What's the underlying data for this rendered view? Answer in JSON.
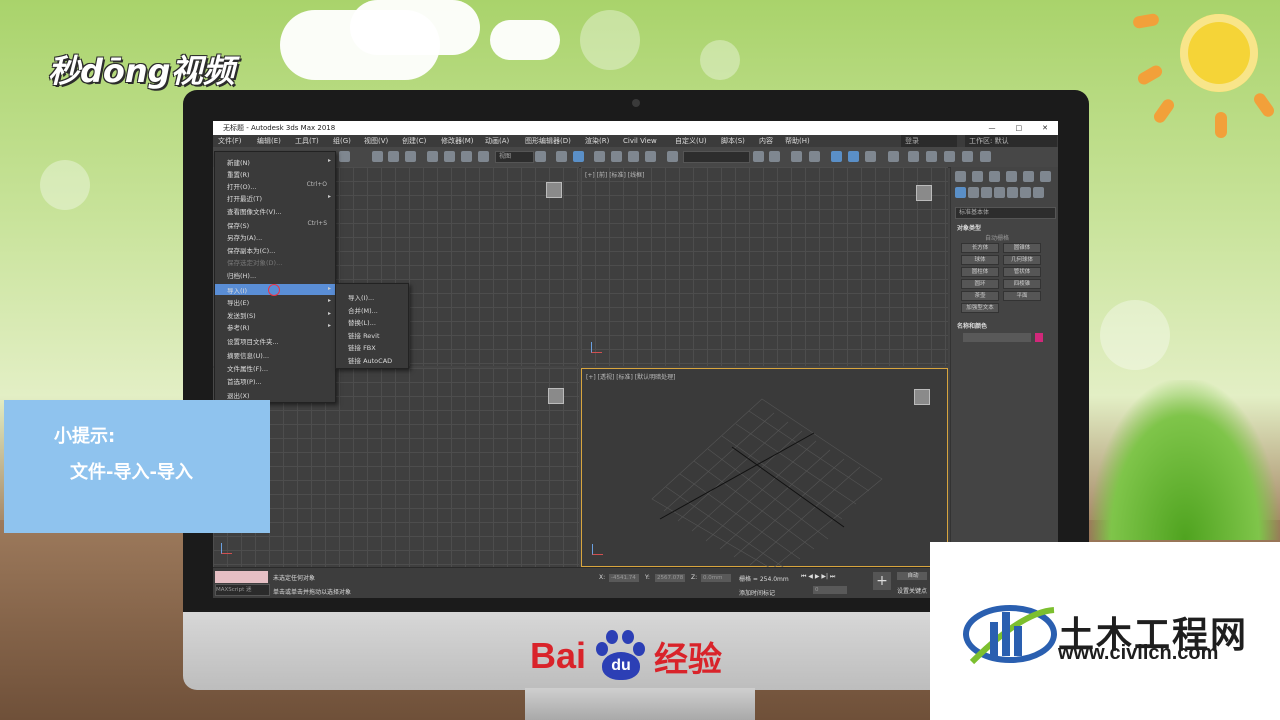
{
  "watermark": {
    "top_left": "秒dōng视频"
  },
  "window": {
    "title": "无标题 - Autodesk 3ds Max 2018",
    "controls": [
      "—",
      "□",
      "✕"
    ],
    "workspace_label": "工作区: 默认",
    "search_placeholder": "登录"
  },
  "menubar": [
    "文件(F)",
    "编辑(E)",
    "工具(T)",
    "组(G)",
    "视图(V)",
    "创建(C)",
    "修改器(M)",
    "动画(A)",
    "图形编辑器(D)",
    "渲染(R)",
    "Civil View",
    "自定义(U)",
    "脚本(S)",
    "内容",
    "帮助(H)"
  ],
  "toolbar": {
    "selection_filter": "视图",
    "selection_set": ""
  },
  "file_menu": {
    "items": [
      {
        "label": "新建(N)",
        "shortcut": "",
        "arrow": "▸",
        "dim": false
      },
      {
        "label": "重置(R)",
        "shortcut": "",
        "arrow": "",
        "dim": false
      },
      {
        "label": "打开(O)...",
        "shortcut": "Ctrl+O",
        "arrow": "",
        "dim": false
      },
      {
        "label": "打开最近(T)",
        "shortcut": "",
        "arrow": "▸",
        "dim": false
      },
      {
        "label": "查看图像文件(V)...",
        "shortcut": "",
        "arrow": "",
        "dim": false
      },
      {
        "label": "保存(S)",
        "shortcut": "Ctrl+S",
        "arrow": "",
        "dim": false
      },
      {
        "label": "另存为(A)...",
        "shortcut": "",
        "arrow": "",
        "dim": false
      },
      {
        "label": "保存副本为(C)...",
        "shortcut": "",
        "arrow": "",
        "dim": false
      },
      {
        "label": "保存选定对象(D)...",
        "shortcut": "",
        "arrow": "",
        "dim": true
      },
      {
        "label": "归档(H)...",
        "shortcut": "",
        "arrow": "",
        "dim": false
      },
      {
        "label": "导入(I)",
        "shortcut": "",
        "arrow": "▸",
        "dim": false
      },
      {
        "label": "导出(E)",
        "shortcut": "",
        "arrow": "▸",
        "dim": false
      },
      {
        "label": "发送到(S)",
        "shortcut": "",
        "arrow": "▸",
        "dim": false
      },
      {
        "label": "参考(R)",
        "shortcut": "",
        "arrow": "▸",
        "dim": false
      },
      {
        "label": "设置项目文件夹...",
        "shortcut": "",
        "arrow": "",
        "dim": false
      },
      {
        "label": "摘要信息(U)...",
        "shortcut": "",
        "arrow": "",
        "dim": false
      },
      {
        "label": "文件属性(F)...",
        "shortcut": "",
        "arrow": "",
        "dim": false
      },
      {
        "label": "首选项(P)...",
        "shortcut": "",
        "arrow": "",
        "dim": false
      },
      {
        "label": "退出(X)",
        "shortcut": "",
        "arrow": "",
        "dim": false
      }
    ],
    "highlighted": "导入(I)"
  },
  "import_submenu": [
    "导入(I)...",
    "合并(M)...",
    "替换(L)...",
    "链接 Revit",
    "链接 FBX",
    "链接 AutoCAD"
  ],
  "viewports": {
    "top_right_label": "[+] [前] [标准] [线框]",
    "bottom_right_label": "[+] [透视] [标准] [默认明暗处理]"
  },
  "command_panel": {
    "dropdown": "标准基本体",
    "section1": "对象类型",
    "autogrid": "自动栅格",
    "buttons": [
      "长方体",
      "圆锥体",
      "球体",
      "几何球体",
      "圆柱体",
      "管状体",
      "圆环",
      "四棱锥",
      "茶壶",
      "平面",
      "加强型文本"
    ],
    "section2": "名称和颜色",
    "color": "#d1287a"
  },
  "statusbar": {
    "maxscript": "MAXScript 迷",
    "msg1": "未选定任何对象",
    "msg2": "单击或单击并拖动以选择对象",
    "x_label": "X:",
    "x_value": "-4541.74",
    "y_label": "Y:",
    "y_value": "2567.078",
    "z_label": "Z:",
    "z_value": "0.0mm",
    "grid": "栅格 = 254.0mm",
    "auto": "自动",
    "add_marker": "添加时间标记",
    "set_key": "设置关键点",
    "frame": "0"
  },
  "tip": {
    "heading": "小提示:",
    "body": "文件-导入-导入"
  },
  "baidu": {
    "brand": "Bai",
    "paw": "du",
    "suffix": "经验"
  },
  "civil": {
    "name": "土木工程网",
    "url": "www.civilcn.com"
  }
}
